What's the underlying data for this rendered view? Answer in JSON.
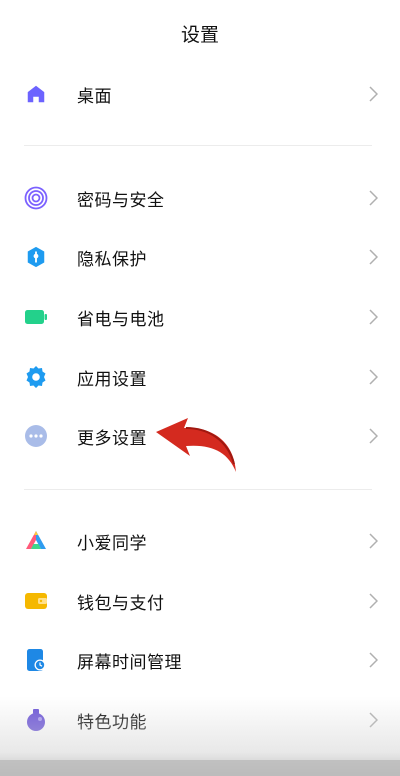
{
  "header": {
    "title": "设置"
  },
  "items": {
    "desktop": {
      "label": "桌面",
      "icon": "home-icon",
      "color": "#6C63FF"
    },
    "password": {
      "label": "密码与安全",
      "icon": "fingerprint-icon",
      "color": "#7B61FF"
    },
    "privacy": {
      "label": "隐私保护",
      "icon": "shield-icon",
      "color": "#1E9BF0"
    },
    "battery": {
      "label": "省电与电池",
      "icon": "battery-icon",
      "color": "#23D18B"
    },
    "apps": {
      "label": "应用设置",
      "icon": "gear-icon",
      "color": "#1E9BF0"
    },
    "more": {
      "label": "更多设置",
      "icon": "more-dots-icon",
      "color": "#9FB4E6"
    },
    "xiaoai": {
      "label": "小爱同学",
      "icon": "xiaoai-icon",
      "color": "#FF5A7A"
    },
    "wallet": {
      "label": "钱包与支付",
      "icon": "wallet-icon",
      "color": "#F5B800"
    },
    "screentime": {
      "label": "屏幕时间管理",
      "icon": "screen-time-icon",
      "color": "#1E88E5"
    },
    "features": {
      "label": "特色功能",
      "icon": "special-features-icon",
      "color": "#6B54D8"
    }
  },
  "annotation": {
    "arrow_color": "#D42A1F",
    "arrow_icon": "red-curved-arrow-icon"
  }
}
